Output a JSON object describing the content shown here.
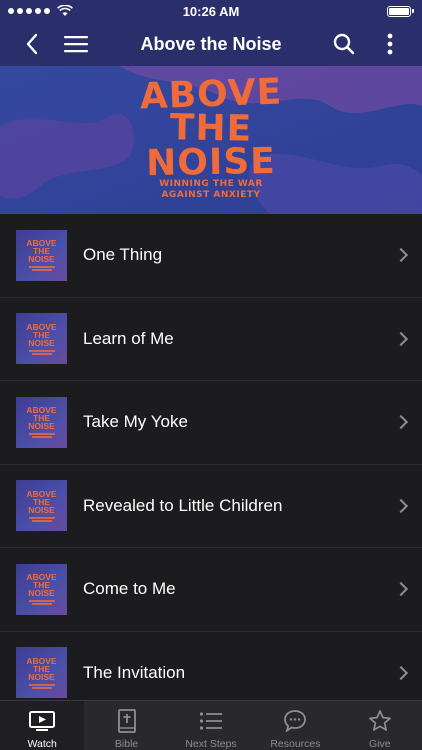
{
  "status_bar": {
    "time": "10:26 AM",
    "battery_level": 1.0
  },
  "nav": {
    "title": "Above the Noise",
    "icons": [
      "back-icon",
      "menu-icon",
      "search-icon",
      "more-icon"
    ]
  },
  "banner": {
    "line1": "ABOVE",
    "line2": "THE",
    "line3": "NOISE",
    "subtitle1": "WINNING THE WAR",
    "subtitle2": "AGAINST ANXIETY",
    "colors": {
      "background": "#3b4fa3",
      "accent": "#f06b3a",
      "blob": "#6a48a0"
    }
  },
  "thumbnail": {
    "line1": "ABOVE",
    "line2": "THE",
    "line3": "NOISE"
  },
  "episodes": [
    {
      "title": "One Thing"
    },
    {
      "title": "Learn of Me"
    },
    {
      "title": "Take My Yoke"
    },
    {
      "title": "Revealed to Little Children"
    },
    {
      "title": "Come to Me"
    },
    {
      "title": "The Invitation"
    }
  ],
  "tabs": [
    {
      "label": "Watch",
      "icon": "tv-icon",
      "active": true
    },
    {
      "label": "Bible",
      "icon": "bible-icon",
      "active": false
    },
    {
      "label": "Next Steps",
      "icon": "list-icon",
      "active": false
    },
    {
      "label": "Resources",
      "icon": "chat-icon",
      "active": false
    },
    {
      "label": "Give",
      "icon": "star-icon",
      "active": false
    }
  ],
  "colors": {
    "nav_background": "#2a2f6b",
    "list_background": "#1c1c1e",
    "tab_background": "#29292b"
  }
}
